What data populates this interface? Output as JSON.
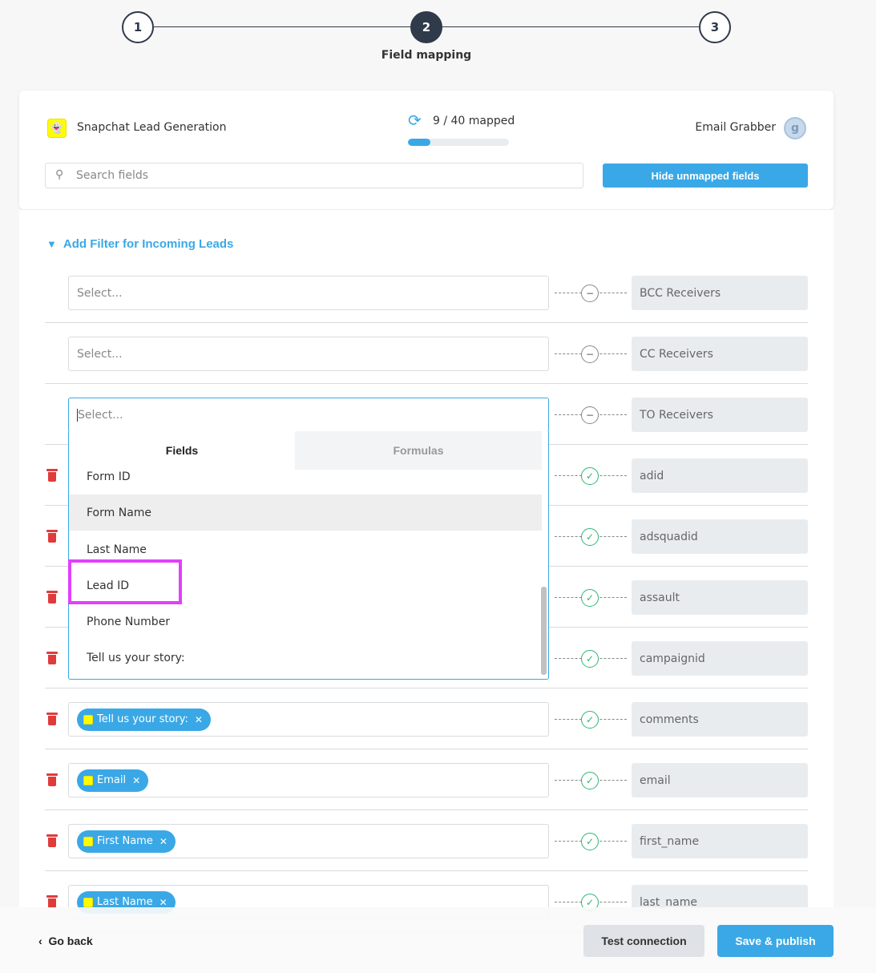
{
  "stepper": {
    "steps": [
      "1",
      "2",
      "3"
    ],
    "active_step": 2,
    "active_label": "Field mapping"
  },
  "header": {
    "source_name": "Snapchat Lead Generation",
    "mapped_text": "9 / 40 mapped",
    "mapped_progress": 0.225,
    "destination_name": "Email Grabber",
    "search_placeholder": "Search fields",
    "hide_button": "Hide unmapped fields"
  },
  "filter_link": "Add Filter for Incoming Leads",
  "rows": [
    {
      "source": "",
      "placeholder": "Select...",
      "status": "empty",
      "destination": "BCC Receivers",
      "deletable": false
    },
    {
      "source": "",
      "placeholder": "Select...",
      "status": "empty",
      "destination": "CC Receivers",
      "deletable": false
    },
    {
      "source": "",
      "placeholder": "Select...",
      "status": "empty",
      "destination": "TO Receivers",
      "deletable": false,
      "focused": true
    },
    {
      "source": "",
      "status": "ok",
      "destination": "adid",
      "deletable": true
    },
    {
      "source": "",
      "status": "ok",
      "destination": "adsquadid",
      "deletable": true
    },
    {
      "source": "",
      "status": "ok",
      "destination": "assault",
      "deletable": true
    },
    {
      "source": "",
      "status": "ok",
      "destination": "campaignid",
      "deletable": true
    },
    {
      "source": "Tell us your story:",
      "status": "ok",
      "destination": "comments",
      "deletable": true
    },
    {
      "source": "Email",
      "status": "ok",
      "destination": "email",
      "deletable": true
    },
    {
      "source": "First Name",
      "status": "ok",
      "destination": "first_name",
      "deletable": true
    },
    {
      "source": "Last Name",
      "status": "ok",
      "destination": "last_name",
      "deletable": true
    }
  ],
  "dropdown": {
    "tabs": [
      "Fields",
      "Formulas"
    ],
    "active_tab": "Fields",
    "items": [
      "Form ID",
      "Form Name",
      "Last Name",
      "Lead ID",
      "Phone Number",
      "Tell us your story:"
    ],
    "hovered_item": "Form Name",
    "highlighted_item": "Lead ID"
  },
  "footer": {
    "back_label": "Go back",
    "test_button": "Test connection",
    "save_button": "Save & publish"
  },
  "colors": {
    "accent": "#3aa8e6",
    "dark": "#2f3a4a",
    "success": "#2bb673",
    "danger": "#e03b3b",
    "highlight": "#e040fb"
  }
}
